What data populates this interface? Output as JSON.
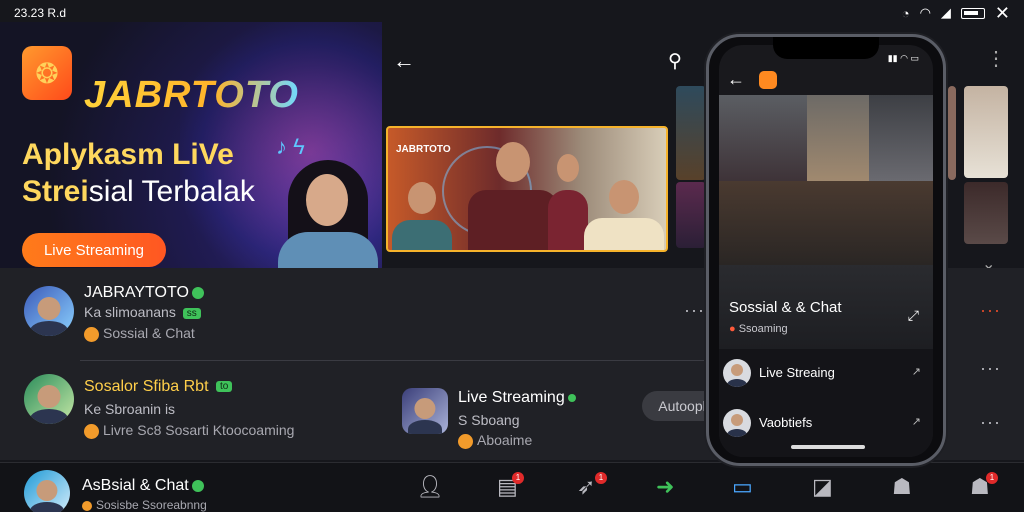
{
  "status_bar": {
    "time": "23.23 R.d"
  },
  "banner": {
    "brand": "JABRTOTO",
    "headline_line1": "Aplykasm LiVe",
    "headline_line2_highlight": "Strei",
    "headline_line2_rest": "sial Terbalak",
    "cta_label": "Live Streaming"
  },
  "video": {
    "overlay_title": "JABRTOTO"
  },
  "chats": [
    {
      "name": "JABRAYTOTO",
      "status": "Ka slimoanans",
      "tag": "ss",
      "message": "Sossial & Chat"
    },
    {
      "name": "Sosalor Sfiba Rbt",
      "status": "Ke Sbroanin is",
      "tag": "to",
      "message": "Livre Sc8 Sosarti Ktoocoaming"
    },
    {
      "name": "Live Streaming",
      "status": "S Sboang",
      "message": "Aboaime"
    },
    {
      "name": "AsBsial & Chat",
      "message": "Sosisbe Ssoreabnng"
    }
  ],
  "autoplay_label": "Autoopl",
  "phone": {
    "panel_title": "Sossial & & Chat",
    "panel_sub": "Ssoaming",
    "list": [
      {
        "label": "Live Streaing"
      },
      {
        "label": "Vaobtiefs"
      }
    ]
  },
  "nav": {
    "badge_1": "1",
    "badge_2": "1",
    "badge_3": "1"
  },
  "colors": {
    "accent": "#ff5722",
    "brand_gold": "#ffd23a",
    "online": "#3fc25a",
    "highlight_border": "#f6b32b"
  }
}
